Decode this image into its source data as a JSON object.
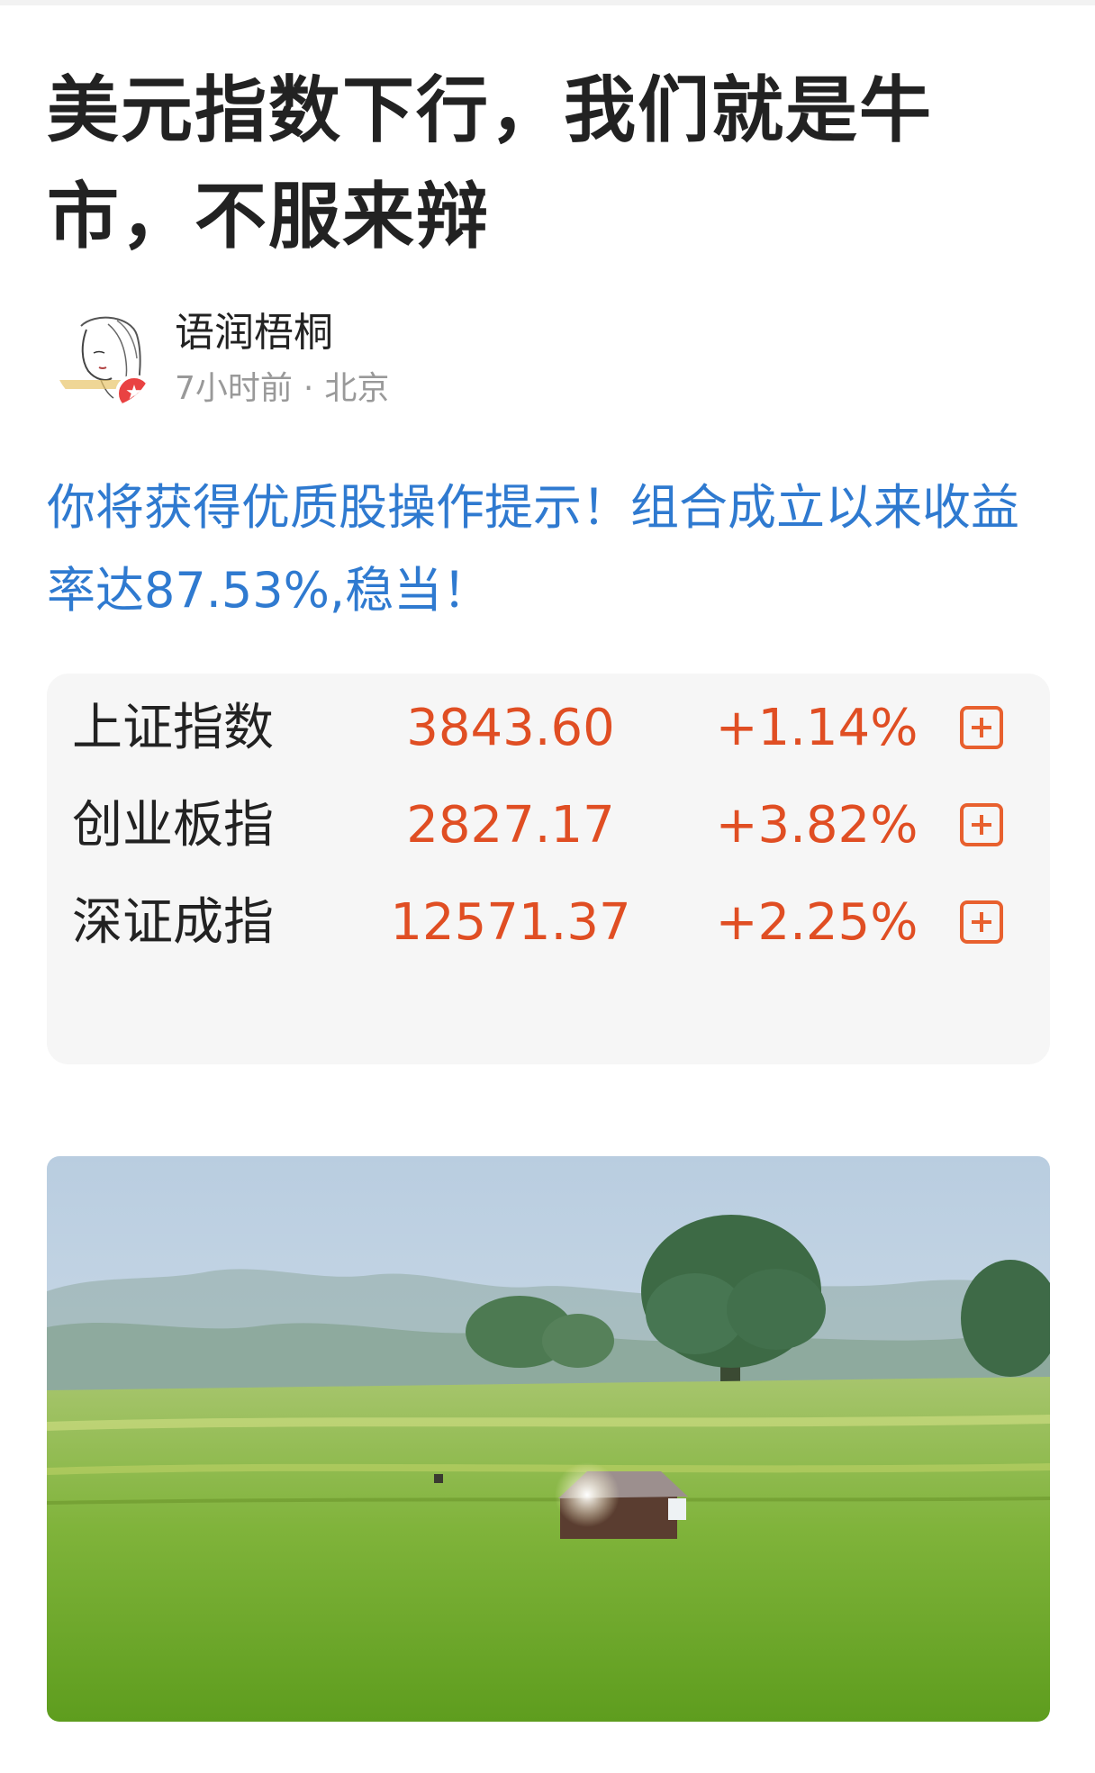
{
  "article": {
    "title": "美元指数下行，我们就是牛市，不服来辩"
  },
  "author": {
    "name": "语润梧桐",
    "time": "7小时前",
    "separator": "·",
    "location": "北京",
    "avatar_icon": "woman-sketch-avatar",
    "badge_icon": "verified-star-icon"
  },
  "promo": {
    "text": "你将获得优质股操作提示！组合成立以来收益率达87.53%,稳当！",
    "color": "#2f7ad0"
  },
  "indices": [
    {
      "name": "上证指数",
      "value": "3843.60",
      "change": "+1.14%"
    },
    {
      "name": "创业板指",
      "value": "2827.17",
      "change": "+3.82%"
    },
    {
      "name": "深证成指",
      "value": "12571.37",
      "change": "+2.25%"
    }
  ],
  "colors": {
    "up": "#e04e23",
    "add_button": "#e8602e",
    "card_bg": "#f6f6f6"
  },
  "photo": {
    "subject": "landscape-farmhouse-field"
  }
}
